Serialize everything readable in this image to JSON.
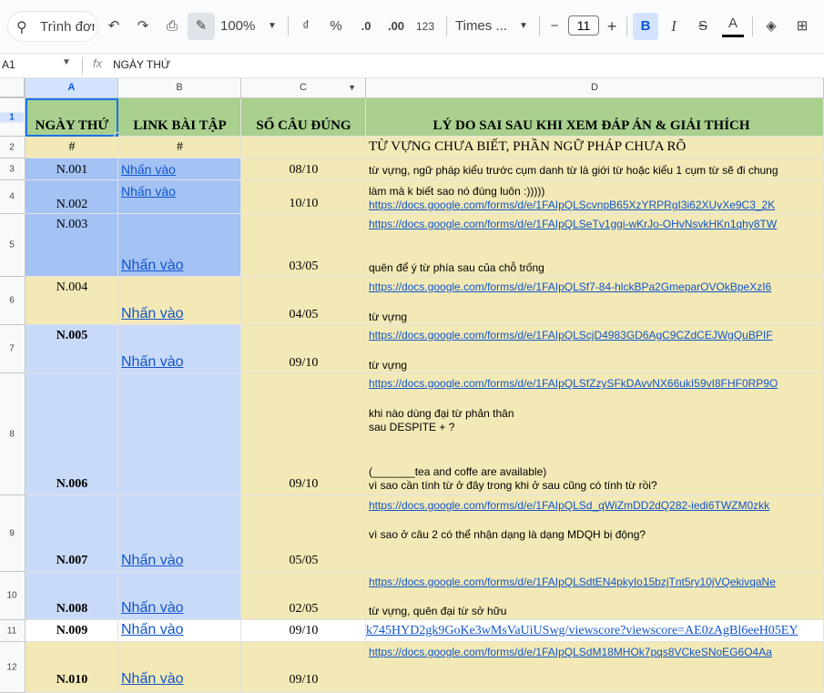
{
  "toolbar": {
    "search_placeholder": "Trình đơn",
    "zoom": "100%",
    "currency": "₫",
    "percent": "%",
    "dec_decrease": ".0",
    "dec_increase": ".00",
    "number_format": "123",
    "font": "Times ...",
    "font_size": "11",
    "minus": "−",
    "plus": "+",
    "bold": "B",
    "italic": "I",
    "strike": "S",
    "text_color": "A"
  },
  "formula_bar": {
    "cell_ref": "A1",
    "fx": "fx",
    "value": "NGÀY THỨ"
  },
  "columns": [
    "A",
    "B",
    "C",
    "D"
  ],
  "rows": [
    "1",
    "2",
    "3",
    "4",
    "5",
    "6",
    "7",
    "8",
    "9",
    "10",
    "11",
    "12"
  ],
  "header": {
    "day": "NGÀY THỨ",
    "link": "LINK BÀI TẬP",
    "correct": "SỐ CÂU ĐÚNG",
    "reason": "LÝ DO SAI SAU KHI XEM ĐÁP ÁN & GIẢI THÍCH"
  },
  "subheader": {
    "a": "#",
    "b": "#",
    "d": "TỪ VỰNG CHƯA BIẾT, PHẦN NGỮ PHÁP CHƯA RÕ"
  },
  "data_rows": [
    {
      "day": "N.001",
      "link": "Nhấn vào",
      "score": "08/10",
      "notes": [
        "từ vựng, ngữ pháp kiểu trước cụm danh từ là giới từ hoặc kiểu 1 cụm từ sẽ đi chung"
      ]
    },
    {
      "day": "N.002",
      "link": "Nhấn vào",
      "score": "10/10",
      "notes": [
        "làm mà k biết sao nó đúng luôn :)))))"
      ],
      "url": "https://docs.google.com/forms/d/e/1FAIpQLScvnpB65XzYRPRgI3i62XUyXe9C3_2K"
    },
    {
      "day": "N.003",
      "link": "Nhấn vào",
      "score": "03/05",
      "url": "https://docs.google.com/forms/d/e/1FAIpQLSeTv1ggi-wKrJo-OHvNsvkHKn1qhy8TW",
      "notes": [
        "quên để ý từ phía sau của chỗ trống"
      ]
    },
    {
      "day": "N.004",
      "link": "Nhấn vào",
      "score": "04/05",
      "url": "https://docs.google.com/forms/d/e/1FAIpQLSf7-84-hlckBPa2GmeparOVOkBpeXzI6",
      "notes": [
        "từ vựng"
      ]
    },
    {
      "day": "N.005",
      "link": "Nhấn vào",
      "score": "09/10",
      "url": "https://docs.google.com/forms/d/e/1FAIpQLScjD4983GD6AgC9CZdCEJWgQuBPIF",
      "notes": [
        "từ vựng"
      ]
    },
    {
      "day": "N.006",
      "link": "",
      "score": "09/10",
      "url": "https://docs.google.com/forms/d/e/1FAIpQLSfZzySFkDAvvNX66ukI59vI8FHF0RP9O",
      "notes": [
        "khi nào dùng đại từ phản thân",
        "sau DESPITE + ?",
        "(_______tea and coffe are available)",
        "vì sao cần tính từ ở đây trong khi ở sau cũng có tính từ rồi?"
      ]
    },
    {
      "day": "N.007",
      "link": "Nhấn vào",
      "score": "05/05",
      "url": "https://docs.google.com/forms/d/e/1FAIpQLSd_qWiZmDD2dQ282-iedi6TWZM0zkk",
      "notes": [
        "vì sao ở câu 2 có thể nhận dạng là dạng MDQH bị động?"
      ]
    },
    {
      "day": "N.008",
      "link": "Nhấn vào",
      "score": "02/05",
      "url": "https://docs.google.com/forms/d/e/1FAIpQLSdtEN4pkyIo15bzjTnt5ry10jVQekivqaNe",
      "notes": [
        "từ vựng, quên đại từ sở hữu"
      ]
    },
    {
      "day": "N.009",
      "link": "Nhấn vào",
      "score": "09/10",
      "url": "k745HYD2gk9GoKe3wMsVaUiUSwg/viewscore?viewscore=AE0zAgBl6eeH05EY"
    },
    {
      "day": "N.010",
      "link": "Nhấn vào",
      "score": "09/10",
      "url": "https://docs.google.com/forms/d/e/1FAIpQLSdM18MHOk7pqs8VCkeSNoEG6O4Aa"
    }
  ],
  "colors": {
    "header_green": "#a9d08e",
    "tan": "#f2e9b6",
    "blue": "#a4c2f4",
    "light_blue": "#c9daf8",
    "link": "#1155cc"
  }
}
